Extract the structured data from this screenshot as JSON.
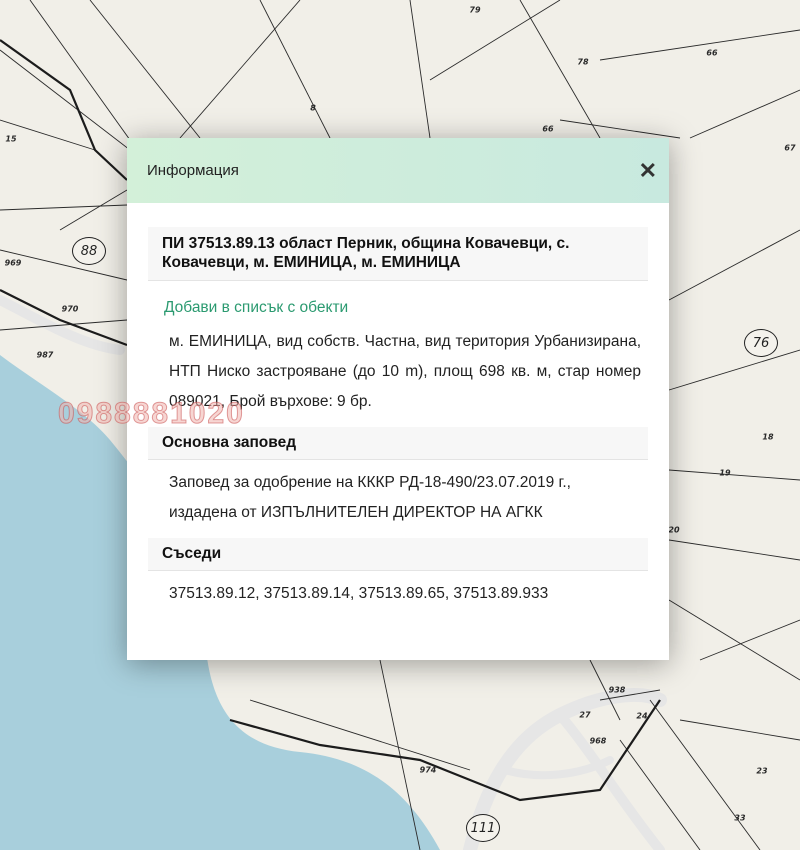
{
  "map": {
    "parcels": [
      {
        "label": "79"
      },
      {
        "label": "66"
      },
      {
        "label": "78"
      },
      {
        "label": "66"
      },
      {
        "label": "8"
      },
      {
        "label": "15"
      },
      {
        "label": "67"
      },
      {
        "label": "969"
      },
      {
        "label": "970"
      },
      {
        "label": "987"
      },
      {
        "label": "18"
      },
      {
        "label": "19"
      },
      {
        "label": "20"
      },
      {
        "label": "938"
      },
      {
        "label": "27"
      },
      {
        "label": "24"
      },
      {
        "label": "968"
      },
      {
        "label": "974"
      },
      {
        "label": "23"
      },
      {
        "label": "33"
      }
    ],
    "circled": [
      {
        "label": "88"
      },
      {
        "label": "76"
      },
      {
        "label": "111"
      }
    ],
    "colors": {
      "background": "#f1efe8",
      "water": "#a8cfdc",
      "road": "#e8e8e8",
      "line": "#2b2b2b"
    }
  },
  "watermark": "0988881020",
  "dialog": {
    "title": "Информация",
    "close_icon": "close-icon",
    "parcel_title": "ПИ 37513.89.13 област Перник, община Ковачевци, с. Ковачевци, м. ЕМИНИЦА, м. ЕМИНИЦА",
    "add_link": "Добави в списък с обекти",
    "description": "м. ЕМИНИЦА, вид собств. Частна, вид територия Урбанизирана, НТП Ниско застрояване (до 10 m), площ 698 кв. м, стар номер 089021, Брой върхове: 9 бр.",
    "order_heading": "Основна заповед",
    "order_text": "Заповед за одобрение на КККР РД-18-490/23.07.2019 г., издадена от ИЗПЪЛНИТЕЛЕН ДИРЕКТОР НА АГКК",
    "neighbors_heading": "Съседи",
    "neighbors_text": "37513.89.12, 37513.89.14, 37513.89.65, 37513.89.933",
    "accent_color": "#2b9a70"
  }
}
